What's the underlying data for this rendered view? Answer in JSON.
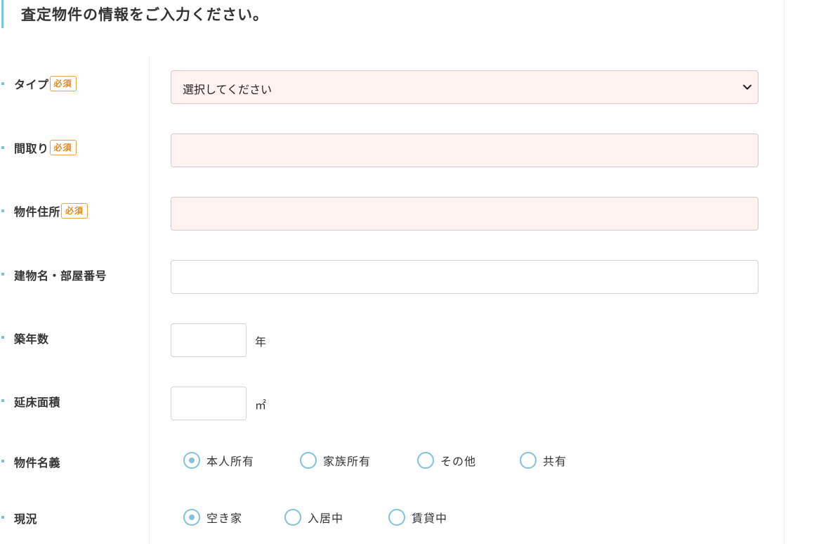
{
  "form": {
    "title": "査定物件の情報をご入力ください。",
    "required_badge": "必須",
    "fields": {
      "type": {
        "label": "タイプ",
        "value": "選択してください"
      },
      "layout": {
        "label": "間取り",
        "value": ""
      },
      "address": {
        "label": "物件住所",
        "value": ""
      },
      "building": {
        "label": "建物名・部屋番号",
        "value": ""
      },
      "age": {
        "label": "築年数",
        "value": "",
        "unit": "年"
      },
      "floor_area": {
        "label": "延床面積",
        "value": "",
        "unit": "㎡"
      },
      "ownership": {
        "label": "物件名義",
        "options": [
          "本人所有",
          "家族所有",
          "その他",
          "共有"
        ],
        "selected": "本人所有"
      },
      "status": {
        "label": "現況",
        "options": [
          "空き家",
          "入居中",
          "賃貸中"
        ],
        "selected": "空き家"
      }
    }
  },
  "colors": {
    "accent": "#7ec3d8",
    "required_badge": "#e08a1e",
    "required_field_bg": "#fff2f1"
  },
  "icons": {
    "select_arrow": "chevron-down-icon",
    "row_marker": "square-bullet-icon"
  }
}
